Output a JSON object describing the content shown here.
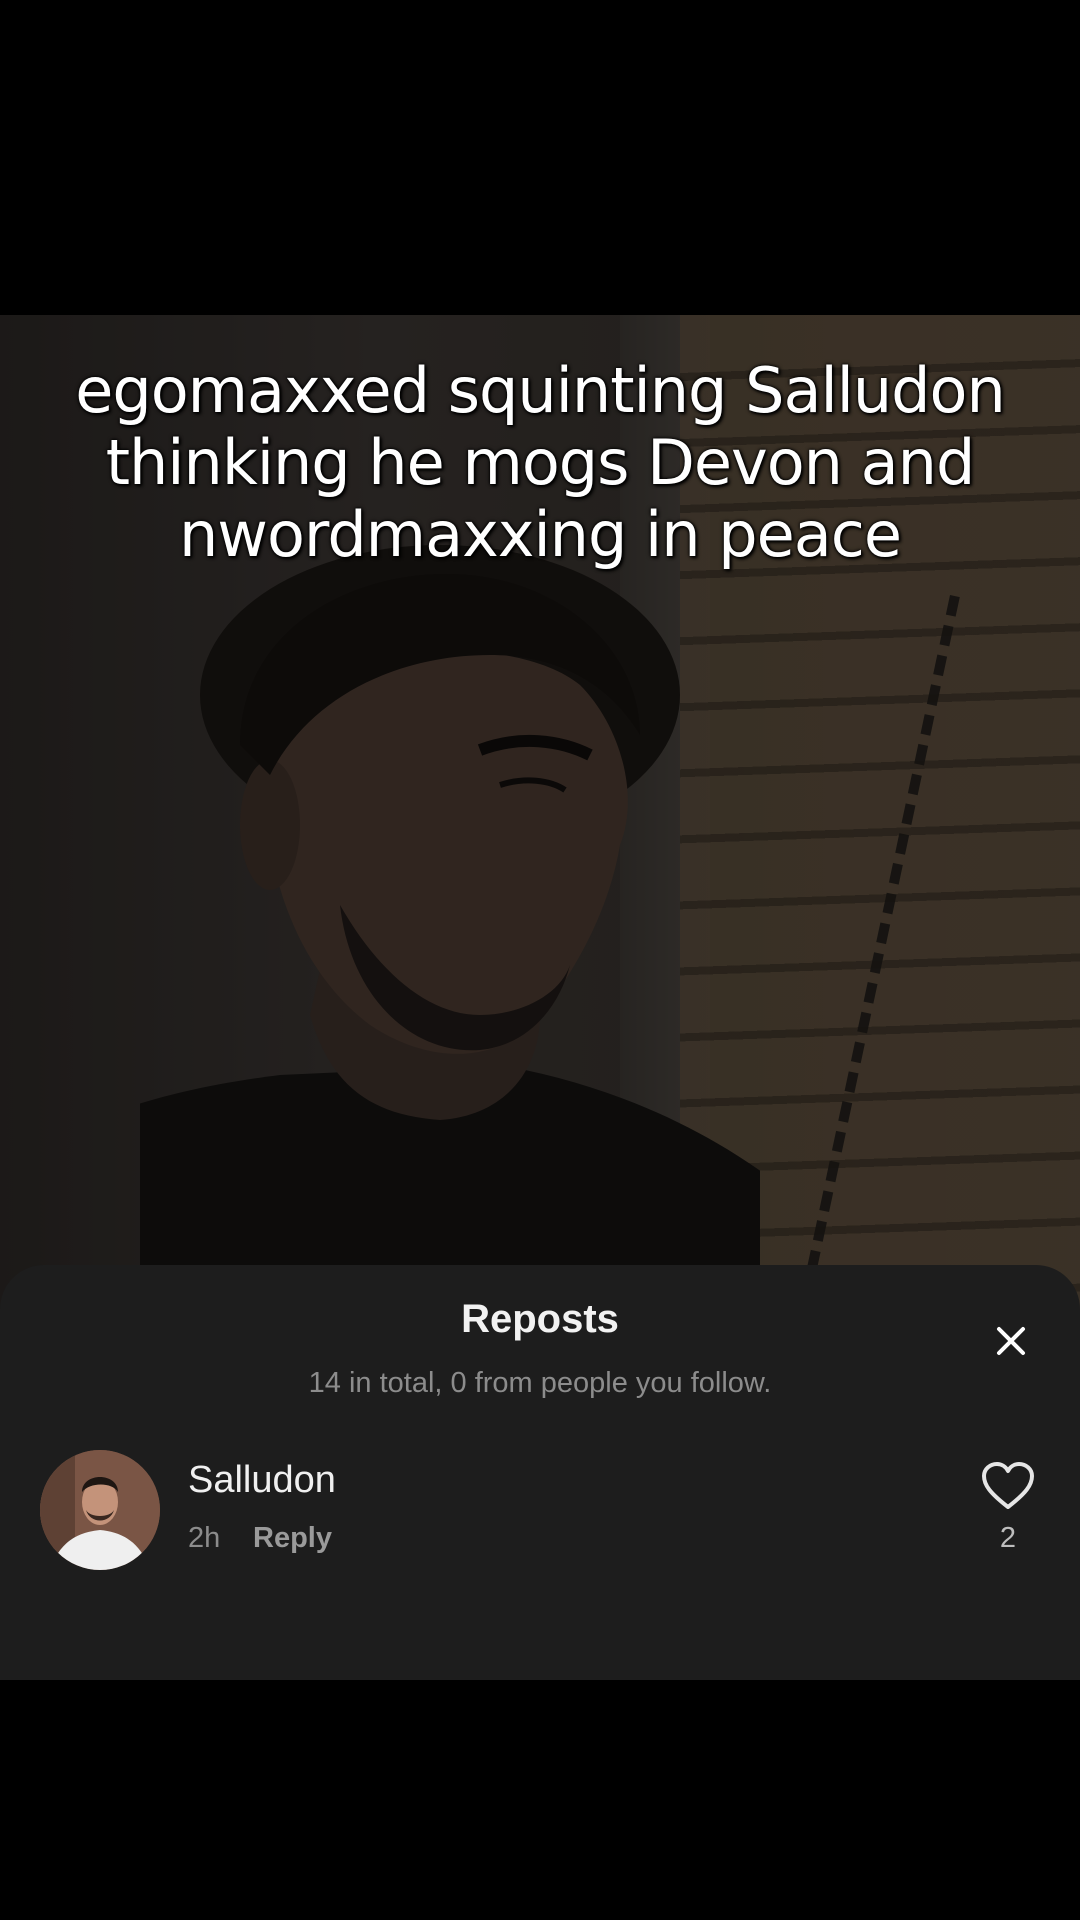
{
  "video": {
    "caption": "egomaxxed squinting Salludon\nthinking he mogs Devon and\nnwordmaxxing in peace"
  },
  "reposts_sheet": {
    "title": "Reposts",
    "subtitle": "14 in total, 0 from people you follow.",
    "close_icon": "close-icon",
    "items": [
      {
        "username": "Salludon",
        "time": "2h",
        "reply_label": "Reply",
        "like_count": "2",
        "like_icon": "heart-icon"
      }
    ]
  },
  "colors": {
    "sheet_background": "#1d1d1d",
    "secondary_text": "#8c8c8c",
    "page_background": "#000000"
  }
}
